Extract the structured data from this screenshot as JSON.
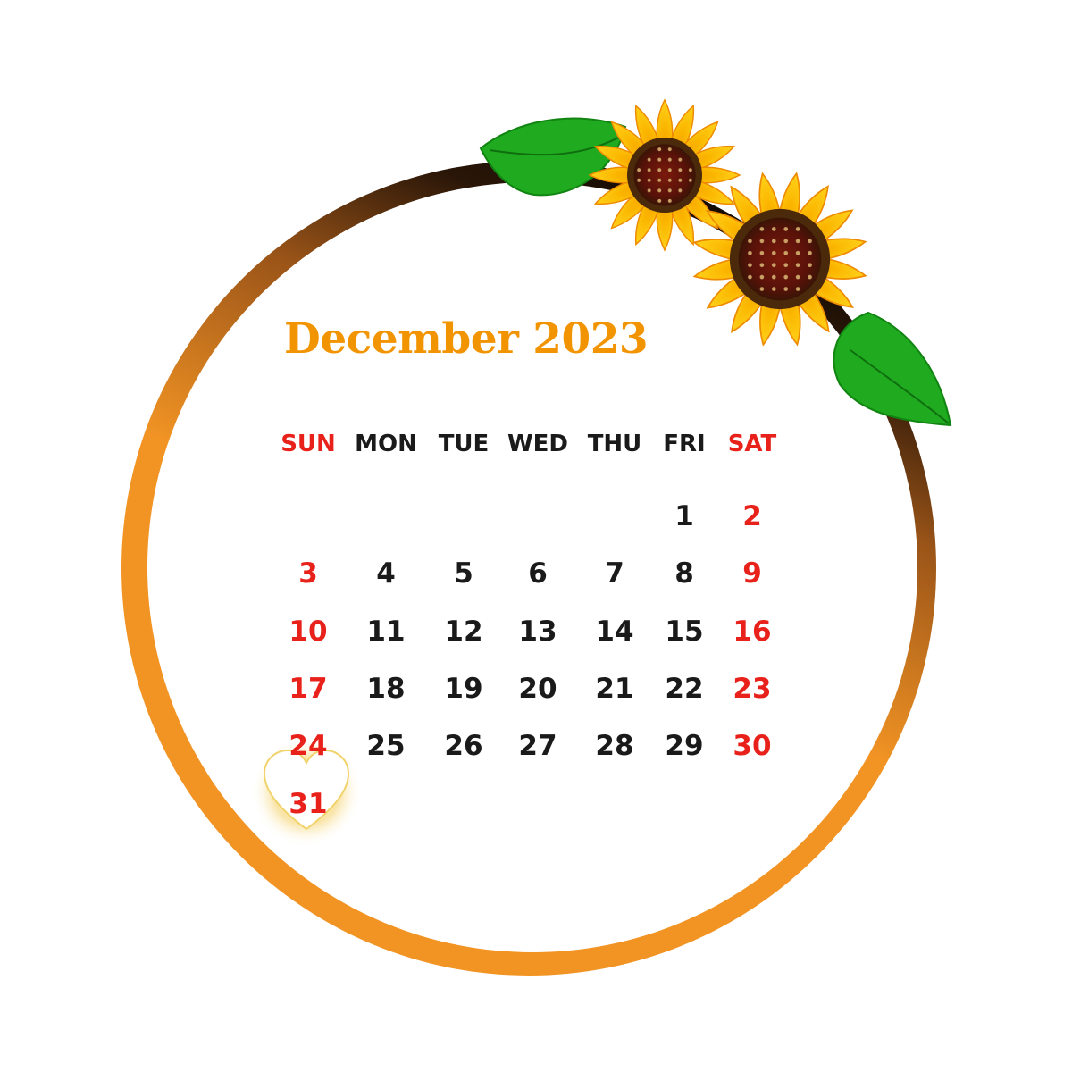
{
  "calendar": {
    "title": "December 2023",
    "weekdays": [
      "SUN",
      "MON",
      "TUE",
      "WED",
      "THU",
      "FRI",
      "SAT"
    ],
    "weeks": [
      [
        "",
        "",
        "",
        "",
        "",
        "1",
        "2"
      ],
      [
        "3",
        "4",
        "5",
        "6",
        "7",
        "8",
        "9"
      ],
      [
        "10",
        "11",
        "12",
        "13",
        "14",
        "15",
        "16"
      ],
      [
        "17",
        "18",
        "19",
        "20",
        "21",
        "22",
        "23"
      ],
      [
        "24",
        "25",
        "26",
        "27",
        "28",
        "29",
        "30"
      ],
      [
        "31",
        "",
        "",
        "",
        "",
        "",
        ""
      ]
    ],
    "highlighted_day": "31"
  },
  "colors": {
    "title": "#f29400",
    "weekday_text": "#1a1a1a",
    "weekend_text": "#e8211b",
    "ring_light": "#f29424",
    "ring_dark": "#1b1006"
  },
  "decorations": {
    "corner_art": "sunflowers-with-leaves",
    "highlight_marker": "heart-icon"
  }
}
